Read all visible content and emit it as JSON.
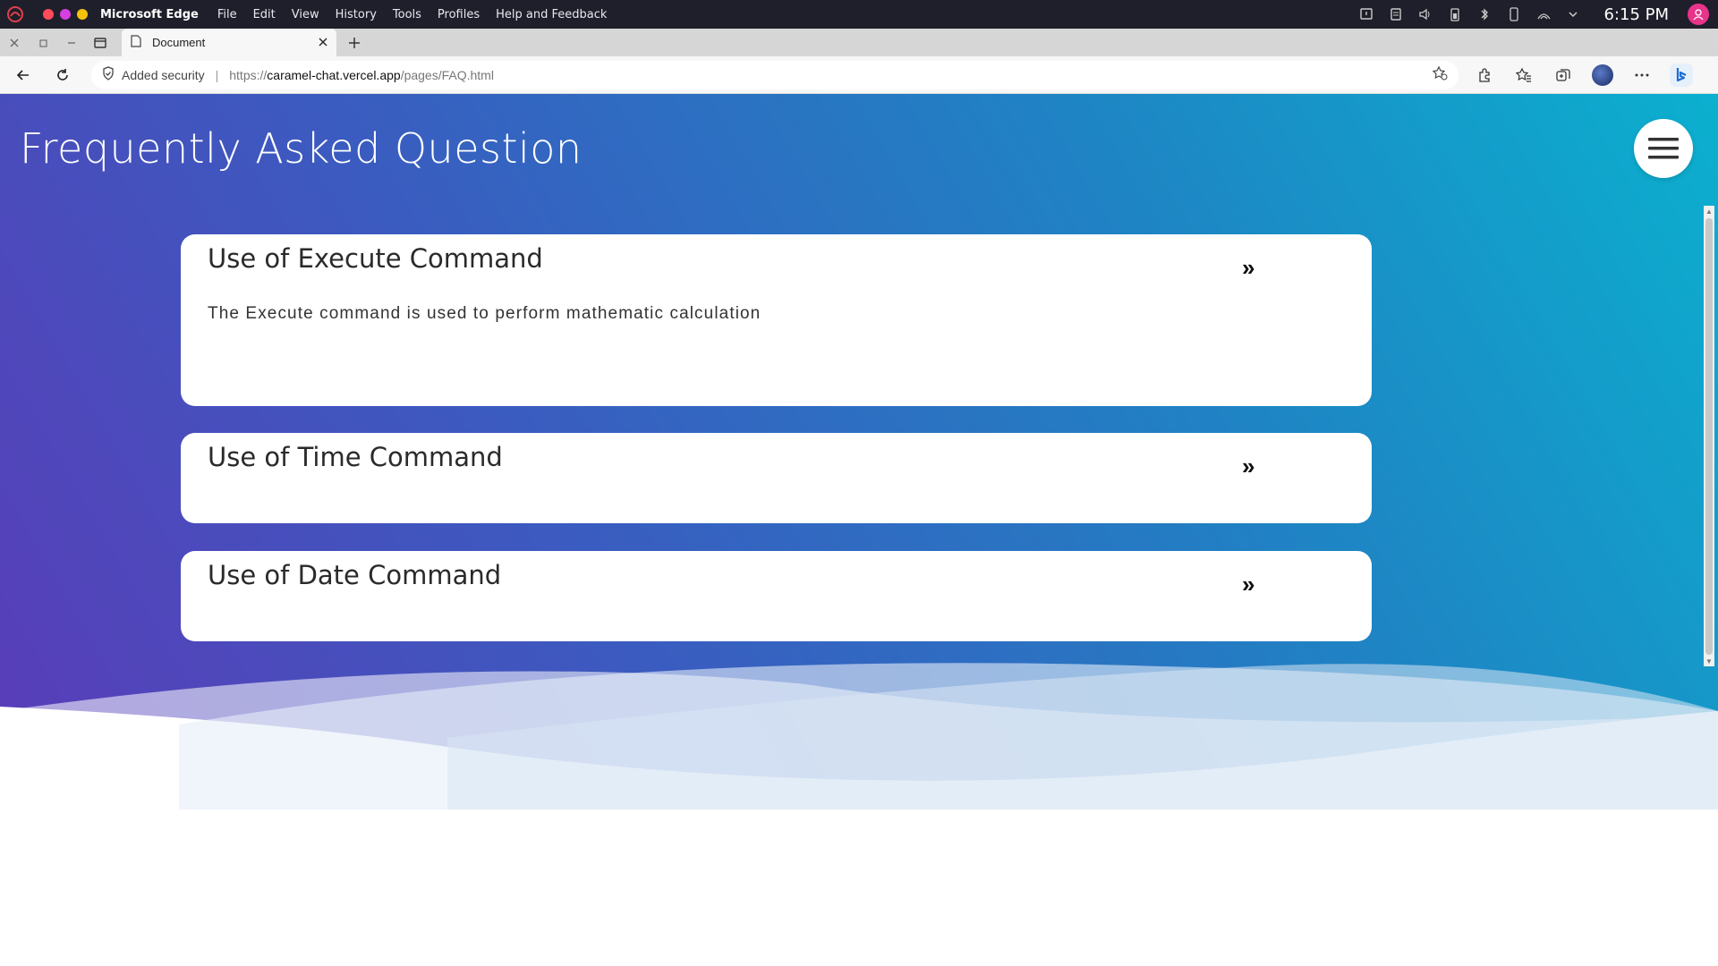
{
  "os_bar": {
    "app_name": "Microsoft Edge",
    "menu": [
      "File",
      "Edit",
      "View",
      "History",
      "Tools",
      "Profiles",
      "Help and Feedback"
    ],
    "clock": "6:15 PM",
    "traffic_colors": [
      "#ff4b5a",
      "#d63fe0",
      "#f4c20d"
    ]
  },
  "browser": {
    "tab_title": "Document",
    "security_label": "Added security",
    "url_scheme": "https://",
    "url_host": "caramel-chat.vercel.app",
    "url_path": "/pages/FAQ.html"
  },
  "page": {
    "title": "Frequently Asked Question",
    "faq": [
      {
        "question": "Use of Execute Command",
        "answer": "The Execute command is used to perform mathematic calculation",
        "arrow": "»"
      },
      {
        "question": "Use of Time Command",
        "arrow": "»"
      },
      {
        "question": "Use of Date Command",
        "arrow": "»"
      }
    ]
  },
  "colors": {
    "gradient_start": "#5b3bb8",
    "gradient_end": "#0bb0cf",
    "card": "#ffffff"
  }
}
